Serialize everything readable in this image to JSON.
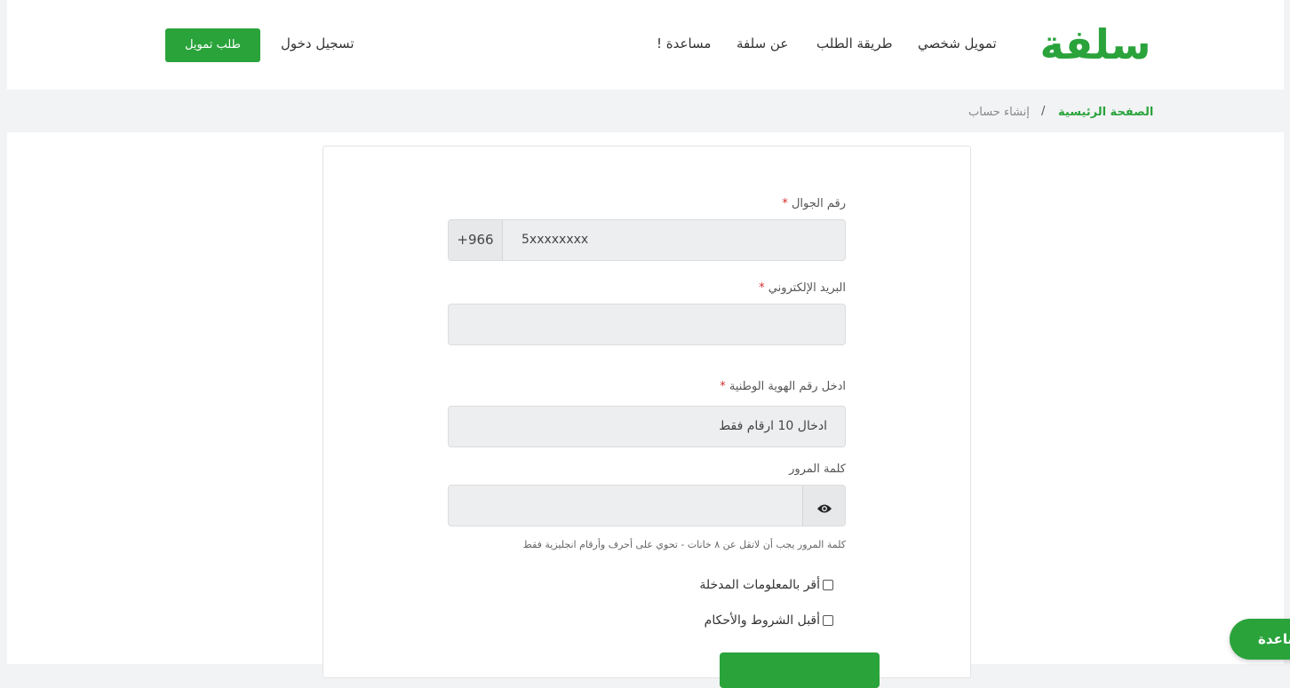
{
  "brand": {
    "logo_text": "سلفة",
    "accent_color": "#2aa33b"
  },
  "nav": {
    "items": [
      {
        "label": "تمويل شخصي"
      },
      {
        "label": "طريقة الطلب"
      },
      {
        "label": "عن سلفة"
      },
      {
        "label": "مساعدة !"
      }
    ],
    "login_label": "تسجيل دخول",
    "request_label": "طلب تمويل"
  },
  "breadcrumb": {
    "home": "الصفحة الرئيسية",
    "separator": "/",
    "current": "إنشاء حساب"
  },
  "form": {
    "phone": {
      "label": "رقم الجوال",
      "prefix": "+966",
      "placeholder": "5xxxxxxxx"
    },
    "email": {
      "label": "البريد الإلكتروني",
      "placeholder": ""
    },
    "national_id": {
      "label": "ادخل رقم الهوية الوطنية",
      "placeholder": "ادخال 10 ارقام فقط"
    },
    "password": {
      "label": "كلمة المرور",
      "placeholder": "",
      "hint": "كلمة المرور يجب أن لاتقل عن ٨ خانات - تحوي على أحرف وأرقام انجليزية فقط"
    },
    "required_marker": "*",
    "checks": [
      {
        "label": "أقر بالمعلومات المدخلة"
      },
      {
        "label": "أقبل الشروط والأحكام"
      }
    ]
  },
  "help_fab": {
    "label": "مساعدة"
  }
}
